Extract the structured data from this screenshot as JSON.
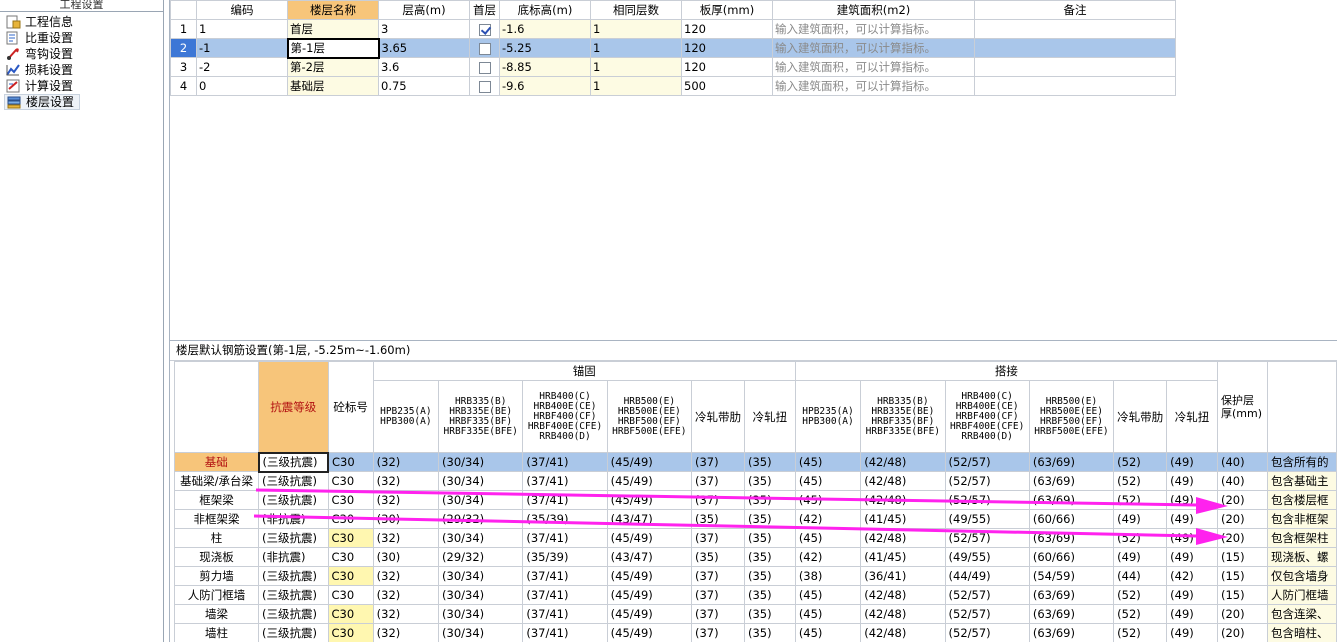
{
  "nav": {
    "title": "工程设置",
    "items": [
      {
        "label": "工程信息",
        "icon": "info-page-icon"
      },
      {
        "label": "比重设置",
        "icon": "weight-icon"
      },
      {
        "label": "弯钩设置",
        "icon": "hook-icon"
      },
      {
        "label": "损耗设置",
        "icon": "loss-chart-icon"
      },
      {
        "label": "计算设置",
        "icon": "calc-icon"
      },
      {
        "label": "楼层设置",
        "icon": "floors-icon"
      }
    ]
  },
  "floor_table": {
    "headers": [
      "编码",
      "楼层名称",
      "层高(m)",
      "首层",
      "底标高(m)",
      "相同层数",
      "板厚(mm)",
      "建筑面积(m2)",
      "备注"
    ],
    "rows": [
      {
        "n": "1",
        "code": "1",
        "name": "首层",
        "height": "3",
        "first": true,
        "bottom": "-1.6",
        "same": "1",
        "slab": "120",
        "area": "输入建筑面积，可以计算指标。",
        "note": ""
      },
      {
        "n": "2",
        "code": "-1",
        "name": "第-1层",
        "height": "3.65",
        "first": false,
        "bottom": "-5.25",
        "same": "1",
        "slab": "120",
        "area": "输入建筑面积，可以计算指标。",
        "note": ""
      },
      {
        "n": "3",
        "code": "-2",
        "name": "第-2层",
        "height": "3.6",
        "first": false,
        "bottom": "-8.85",
        "same": "1",
        "slab": "120",
        "area": "输入建筑面积，可以计算指标。",
        "note": ""
      },
      {
        "n": "4",
        "code": "0",
        "name": "基础层",
        "height": "0.75",
        "first": false,
        "bottom": "-9.6",
        "same": "1",
        "slab": "500",
        "area": "输入建筑面积，可以计算指标。",
        "note": ""
      }
    ]
  },
  "rebar": {
    "title": "楼层默认钢筋设置(第-1层, -5.25m~-1.60m)",
    "headers": {
      "seismic": "抗震等级",
      "concrete": "砼标号",
      "anchor": "锚固",
      "lap": "搭接",
      "cover": "保护层厚(mm)",
      "c1": "HPB235(A)\nHPB300(A)",
      "c2": "HRB335(B)\nHRB335E(BE)\nHRBF335(BF)\nHRBF335E(BFE)",
      "c3": "HRB400(C)\nHRB400E(CE)\nHRBF400(CF)\nHRBF400E(CFE)\nRRB400(D)",
      "c4": "HRB500(E)\nHRB500E(EE)\nHRBF500(EF)\nHRBF500E(EFE)",
      "c5": "冷轧带肋",
      "c6": "冷轧扭"
    },
    "rows": [
      {
        "name": "基础",
        "seismic": "(三级抗震)",
        "concrete": "C30",
        "cy": false,
        "a": [
          "(32)",
          "(30/34)",
          "(37/41)",
          "(45/49)",
          "(37)",
          "(35)"
        ],
        "l": [
          "(45)",
          "(42/48)",
          "(52/57)",
          "(63/69)",
          "(52)",
          "(49)"
        ],
        "cover": "(40)",
        "desc": "包含所有的"
      },
      {
        "name": "基础梁/承台梁",
        "seismic": "(三级抗震)",
        "concrete": "C30",
        "cy": false,
        "a": [
          "(32)",
          "(30/34)",
          "(37/41)",
          "(45/49)",
          "(37)",
          "(35)"
        ],
        "l": [
          "(45)",
          "(42/48)",
          "(52/57)",
          "(63/69)",
          "(52)",
          "(49)"
        ],
        "cover": "(40)",
        "desc": "包含基础主"
      },
      {
        "name": "框架梁",
        "seismic": "(三级抗震)",
        "concrete": "C30",
        "cy": false,
        "a": [
          "(32)",
          "(30/34)",
          "(37/41)",
          "(45/49)",
          "(37)",
          "(35)"
        ],
        "l": [
          "(45)",
          "(42/48)",
          "(52/57)",
          "(63/69)",
          "(52)",
          "(49)"
        ],
        "cover": "(20)",
        "desc": "包含楼层框"
      },
      {
        "name": "非框架梁",
        "seismic": "(非抗震)",
        "concrete": "C30",
        "cy": false,
        "a": [
          "(30)",
          "(29/32)",
          "(35/39)",
          "(43/47)",
          "(35)",
          "(35)"
        ],
        "l": [
          "(42)",
          "(41/45)",
          "(49/55)",
          "(60/66)",
          "(49)",
          "(49)"
        ],
        "cover": "(20)",
        "desc": "包含非框架"
      },
      {
        "name": "柱",
        "seismic": "(三级抗震)",
        "concrete": "C30",
        "cy": true,
        "a": [
          "(32)",
          "(30/34)",
          "(37/41)",
          "(45/49)",
          "(37)",
          "(35)"
        ],
        "l": [
          "(45)",
          "(42/48)",
          "(52/57)",
          "(63/69)",
          "(52)",
          "(49)"
        ],
        "cover": "(20)",
        "desc": "包含框架柱"
      },
      {
        "name": "现浇板",
        "seismic": "(非抗震)",
        "concrete": "C30",
        "cy": false,
        "a": [
          "(30)",
          "(29/32)",
          "(35/39)",
          "(43/47)",
          "(35)",
          "(35)"
        ],
        "l": [
          "(42)",
          "(41/45)",
          "(49/55)",
          "(60/66)",
          "(49)",
          "(49)"
        ],
        "cover": "(15)",
        "desc": "现浇板、螺"
      },
      {
        "name": "剪力墙",
        "seismic": "(三级抗震)",
        "concrete": "C30",
        "cy": true,
        "a": [
          "(32)",
          "(30/34)",
          "(37/41)",
          "(45/49)",
          "(37)",
          "(35)"
        ],
        "l": [
          "(38)",
          "(36/41)",
          "(44/49)",
          "(54/59)",
          "(44)",
          "(42)"
        ],
        "cover": "(15)",
        "desc": "仅包含墙身"
      },
      {
        "name": "人防门框墙",
        "seismic": "(三级抗震)",
        "concrete": "C30",
        "cy": false,
        "a": [
          "(32)",
          "(30/34)",
          "(37/41)",
          "(45/49)",
          "(37)",
          "(35)"
        ],
        "l": [
          "(45)",
          "(42/48)",
          "(52/57)",
          "(63/69)",
          "(52)",
          "(49)"
        ],
        "cover": "(15)",
        "desc": "人防门框墙"
      },
      {
        "name": "墙梁",
        "seismic": "(三级抗震)",
        "concrete": "C30",
        "cy": true,
        "a": [
          "(32)",
          "(30/34)",
          "(37/41)",
          "(45/49)",
          "(37)",
          "(35)"
        ],
        "l": [
          "(45)",
          "(42/48)",
          "(52/57)",
          "(63/69)",
          "(52)",
          "(49)"
        ],
        "cover": "(20)",
        "desc": "包含连梁、"
      },
      {
        "name": "墙柱",
        "seismic": "(三级抗震)",
        "concrete": "C30",
        "cy": true,
        "a": [
          "(32)",
          "(30/34)",
          "(37/41)",
          "(45/49)",
          "(37)",
          "(35)"
        ],
        "l": [
          "(45)",
          "(42/48)",
          "(52/57)",
          "(63/69)",
          "(52)",
          "(49)"
        ],
        "cover": "(20)",
        "desc": "包含暗柱、"
      }
    ]
  },
  "colors": {
    "accent": "#f7c57a",
    "selection": "#a9c6ea",
    "yellow_cell": "#fff7b0",
    "arrow": "#ff22ee"
  }
}
